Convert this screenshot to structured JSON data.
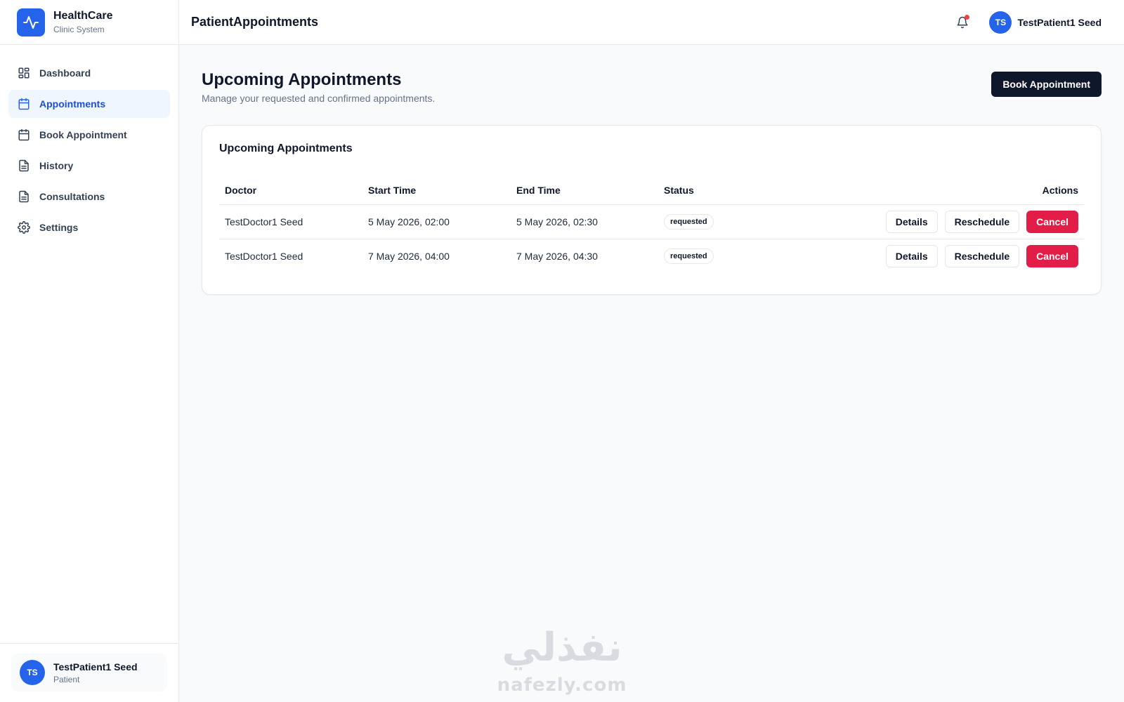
{
  "brand": {
    "name": "HealthCare",
    "subtitle": "Clinic System"
  },
  "sidebar": {
    "items": [
      {
        "label": "Dashboard",
        "icon": "dashboard-icon",
        "active": false
      },
      {
        "label": "Appointments",
        "icon": "calendar-icon",
        "active": true
      },
      {
        "label": "Book Appointment",
        "icon": "calendar-icon",
        "active": false
      },
      {
        "label": "History",
        "icon": "document-icon",
        "active": false
      },
      {
        "label": "Consultations",
        "icon": "document-icon",
        "active": false
      },
      {
        "label": "Settings",
        "icon": "gear-icon",
        "active": false
      }
    ]
  },
  "header": {
    "title": "PatientAppointments",
    "user_initials": "TS",
    "user_name": "TestPatient1 Seed",
    "notification_dot_color": "#ef4444"
  },
  "page": {
    "title": "Upcoming Appointments",
    "subtitle": "Manage your requested and confirmed appointments.",
    "book_button": "Book Appointment"
  },
  "card": {
    "title": "Upcoming Appointments",
    "columns": [
      "Doctor",
      "Start Time",
      "End Time",
      "Status",
      "Actions"
    ],
    "rows": [
      {
        "doctor": "TestDoctor1 Seed",
        "start": "5 May 2026, 02:00",
        "end": "5 May 2026, 02:30",
        "status": "requested"
      },
      {
        "doctor": "TestDoctor1 Seed",
        "start": "7 May 2026, 04:00",
        "end": "7 May 2026, 04:30",
        "status": "requested"
      }
    ],
    "actions": {
      "details": "Details",
      "reschedule": "Reschedule",
      "cancel": "Cancel"
    }
  },
  "footer_user": {
    "initials": "TS",
    "name": "TestPatient1 Seed",
    "role": "Patient"
  },
  "watermark": {
    "arabic": "نفذلي",
    "latin": "nafezly.com"
  },
  "colors": {
    "accent": "#2563eb",
    "danger": "#e11d48",
    "primary_button": "#0f172a"
  }
}
